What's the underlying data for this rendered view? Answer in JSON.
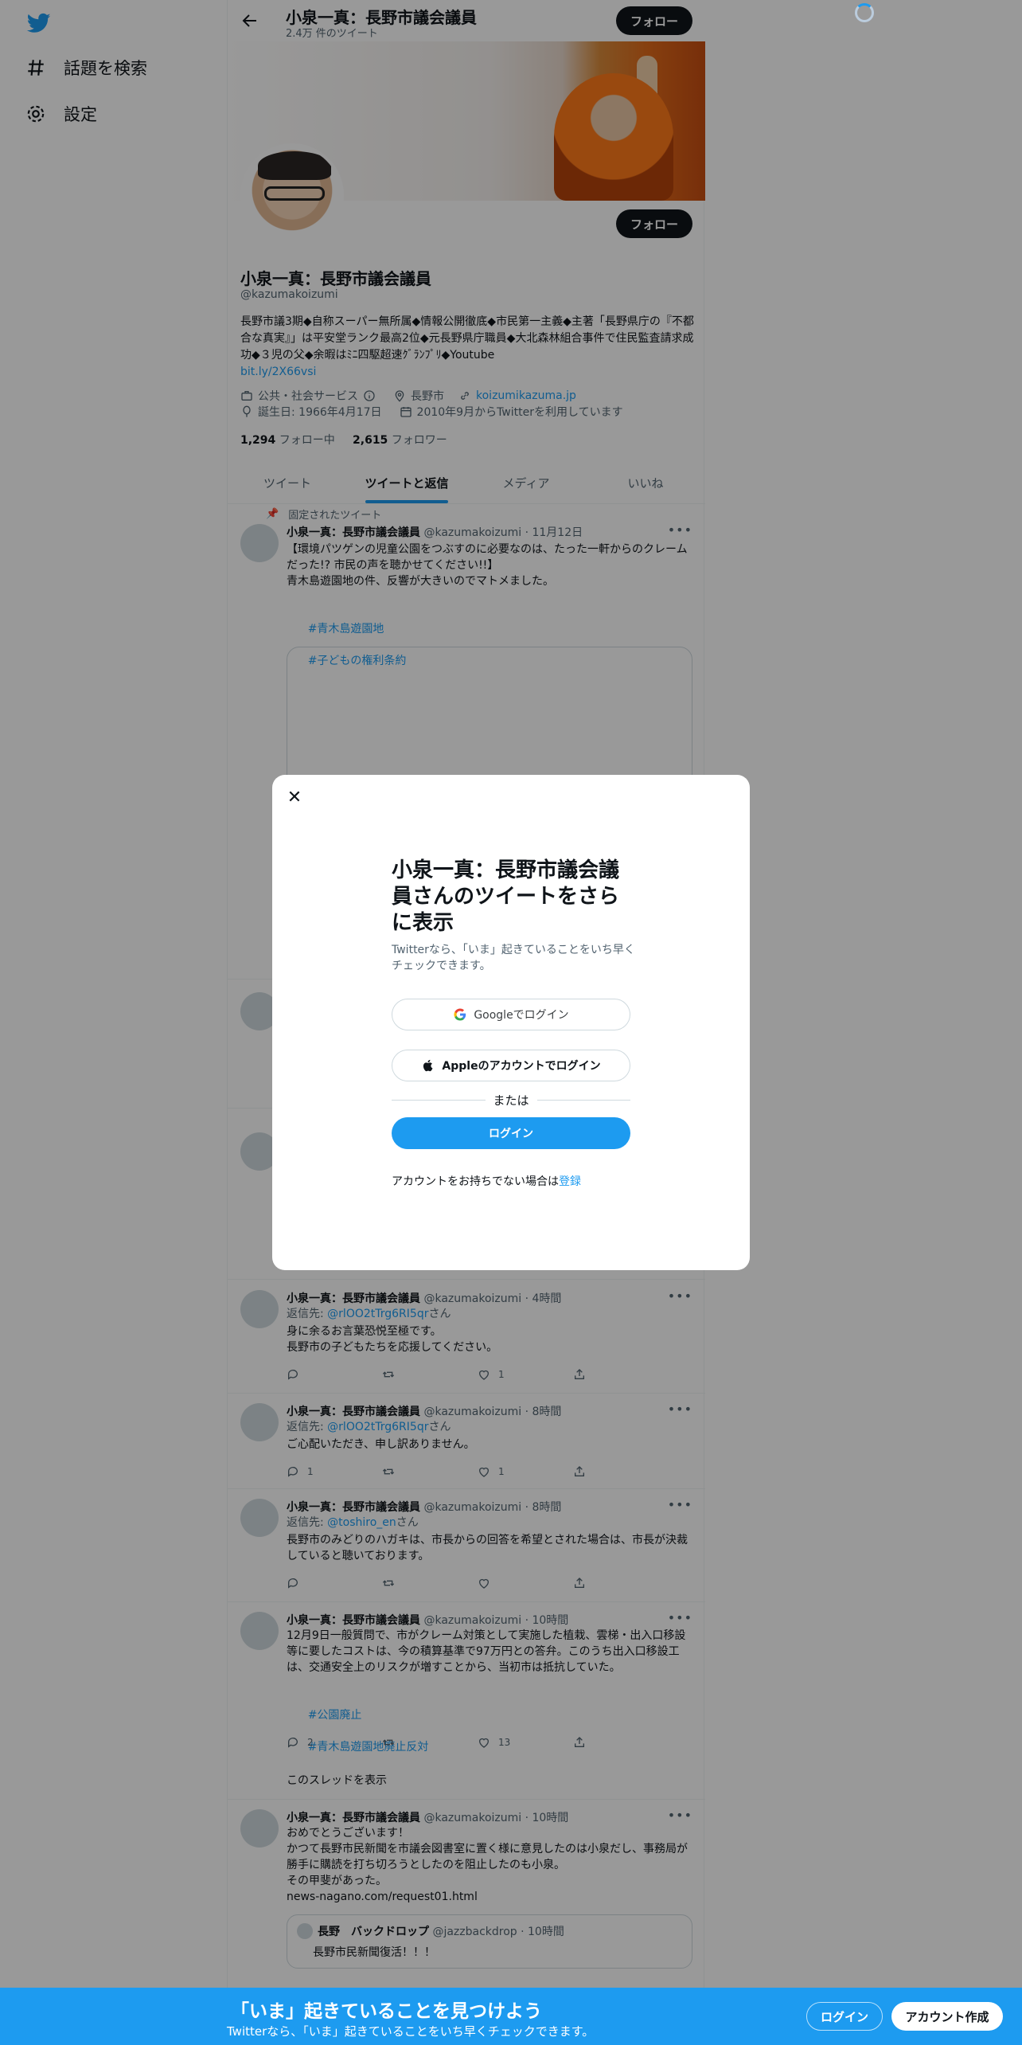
{
  "nav": {
    "items": [
      {
        "label": "話題を検索",
        "icon": "hashtag-icon"
      },
      {
        "label": "設定",
        "icon": "gear-icon"
      }
    ]
  },
  "header": {
    "title": "小泉一真：長野市議会議員",
    "tweet_count": "2.4万 件のツイート",
    "follow_label": "フォロー"
  },
  "profile": {
    "name": "小泉一真：長野市議会議員",
    "handle": "@kazumakoizumi",
    "bio": "長野市議3期◆自称スーパー無所属◆情報公開徹底◆市民第一主義◆主著「長野県庁の『不都合な真実』」は平安堂ランク最高2位◆元長野県庁職員◆大北森林組合事件で住民監査請求成功◆３児の父◆余暇はﾐﾆ四駆超速ｸﾞﾗﾝﾌﾟﾘ◆Youtube",
    "bio_link": "bit.ly/2X66vsi",
    "category": "公共・社会サービス",
    "location": "長野市",
    "website": "koizumikazuma.jp",
    "birthday": "誕生日: 1966年4月17日",
    "joined": "2010年9月からTwitterを利用しています",
    "following_count": "1,294",
    "following_label": "フォロー中",
    "followers_count": "2,615",
    "followers_label": "フォロワー",
    "follow_label": "フォロー"
  },
  "tabs": [
    "ツイート",
    "ツイートと返信",
    "メディア",
    "いいね"
  ],
  "pinned": {
    "label": "固定されたツイート",
    "name": "小泉一真：長野市議会議員",
    "meta": "@kazumakoizumi · 11月12日",
    "text": "【環境パツゲンの児童公園をつぶすのに必要なのは、たった一軒からのクレームだった!? 市民の声を聴かせてください!!】\n青木島遊園地の件、反響が大きいのでマトメました。",
    "tags": [
      "#青木島遊園地",
      "#子どもの権利条約"
    ]
  },
  "tweets": [
    {
      "name": "小泉一真：長野市議会議員",
      "meta": "@kazumakoizumi · 4時間",
      "reply_prefix": "返信先: ",
      "reply_to": "@rlOO2tTrg6RI5qr",
      "reply_suffix": "さん",
      "text": "身に余るお言葉恐悦至極です。\n長野市の子どもたちを応援してください。",
      "replies": "",
      "retweets": "",
      "likes": "1"
    },
    {
      "name": "小泉一真：長野市議会議員",
      "meta": "@kazumakoizumi · 8時間",
      "reply_prefix": "返信先: ",
      "reply_to": "@rlOO2tTrg6RI5qr",
      "reply_suffix": "さん",
      "text": "ご心配いただき、申し訳ありません。",
      "replies": "1",
      "retweets": "",
      "likes": "1"
    },
    {
      "name": "小泉一真：長野市議会議員",
      "meta": "@kazumakoizumi · 8時間",
      "reply_prefix": "返信先: ",
      "reply_to": "@toshiro_en",
      "reply_suffix": "さん",
      "text": "長野市のみどりのハガキは、市長からの回答を希望とされた場合は、市長が決裁していると聴いております。",
      "replies": "",
      "retweets": "",
      "likes": ""
    },
    {
      "name": "小泉一真：長野市議会議員",
      "meta": "@kazumakoizumi · 10時間",
      "text": "12月9日一般質問で、市がクレーム対策として実施した植栽、雲梯・出入口移設等に要したコストは、今の積算基準で97万円との答弁。このうち出入口移設工は、交通安全上のリスクが増すことから、当初市は抵抗していた。",
      "tags": [
        "#公園廃止",
        "#青木島遊園地廃止反対"
      ],
      "replies": "2",
      "retweets": "",
      "likes": "13",
      "thread_label": "このスレッドを表示"
    },
    {
      "name": "小泉一真：長野市議会議員",
      "meta": "@kazumakoizumi · 10時間",
      "text": "おめでとうございます！\nかつて長野市民新聞を市議会図書室に置く様に意見したのは小泉だし、事務局が勝手に購読を打ち切ろうとしたのを阻止したのも小泉。\nその甲斐があった。",
      "link": "news-nagano.com/request01.html",
      "quote_name": "長野　バックドロップ",
      "quote_meta": "@jazzbackdrop · 10時間",
      "quote_text": "長野市民新聞復活！！！"
    }
  ],
  "modal": {
    "title": "小泉一真：長野市議会議員さんのツイートをさらに表示",
    "subtitle": "Twitterなら、「いま」起きていることをいち早くチェックできます。",
    "google_label": "Googleでログイン",
    "apple_label": "Appleのアカウントでログイン",
    "or_label": "または",
    "login_label": "ログイン",
    "signup_prompt": "アカウントをお持ちでない場合は",
    "signup_link": "登録"
  },
  "bottom_bar": {
    "title": "「いま」起きていることを見つけよう",
    "subtitle": "Twitterなら、「いま」起きていることをいち早くチェックできます。",
    "login_label": "ログイン",
    "signup_label": "アカウント作成"
  },
  "colors": {
    "accent": "#1d9bf0",
    "text": "#0f1419",
    "muted": "#536471"
  }
}
